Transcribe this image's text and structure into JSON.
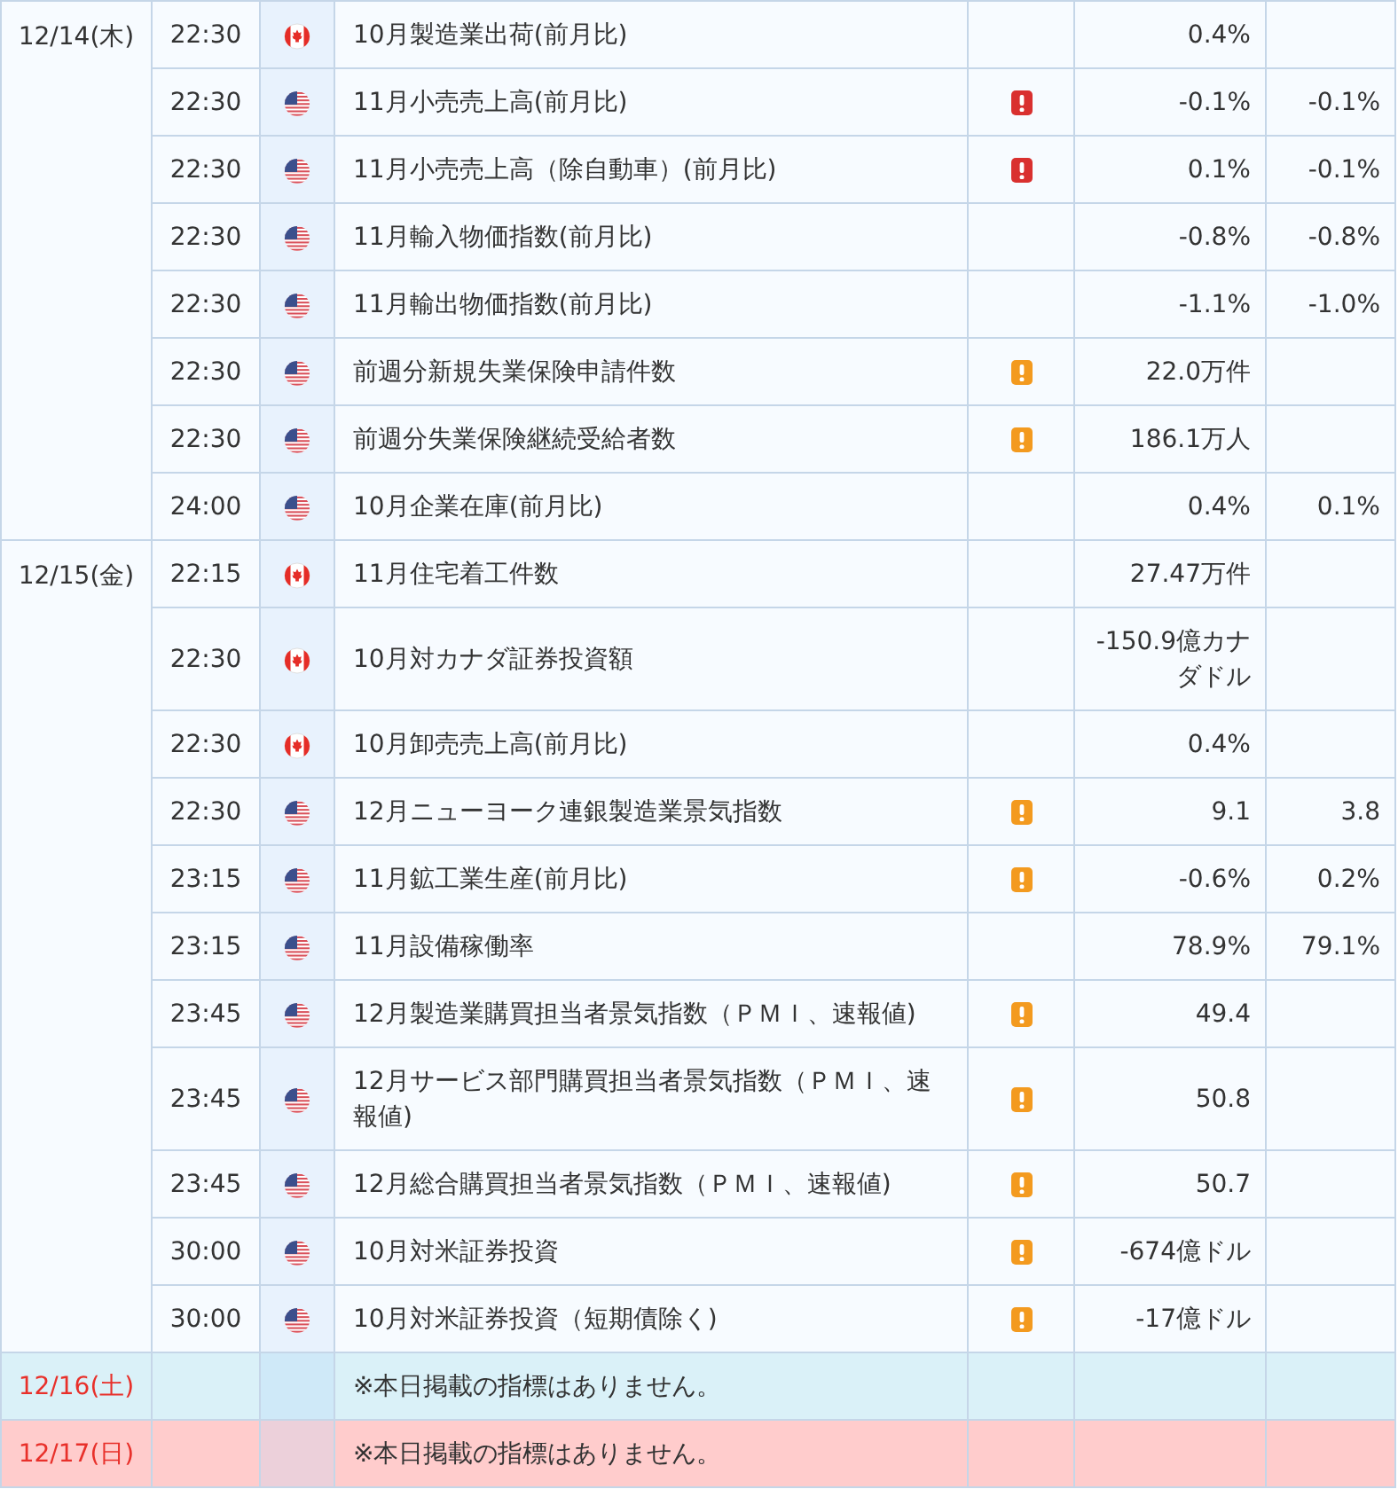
{
  "days": [
    {
      "date": "12/14(木)",
      "kind": "weekday",
      "events": [
        {
          "time": "22:30",
          "flag": {
            "kind": "canada"
          },
          "name": "10月製造業出荷(前月比)",
          "column_6": "0.4%"
        },
        {
          "time": "22:30",
          "flag": {
            "kind": "usa"
          },
          "name": "11月小売売上高(前月比)",
          "alert": {
            "kind": "high"
          },
          "column_6": "-0.1%",
          "column_7": "-0.1%"
        },
        {
          "time": "22:30",
          "flag": {
            "kind": "usa"
          },
          "name": "11月小売売上高（除自動車）(前月比)",
          "alert": {
            "kind": "high"
          },
          "column_6": "0.1%",
          "column_7": "-0.1%"
        },
        {
          "time": "22:30",
          "flag": {
            "kind": "usa"
          },
          "name": "11月輸入物価指数(前月比)",
          "column_6": "-0.8%",
          "column_7": "-0.8%"
        },
        {
          "time": "22:30",
          "flag": {
            "kind": "usa"
          },
          "name": "11月輸出物価指数(前月比)",
          "column_6": "-1.1%",
          "column_7": "-1.0%"
        },
        {
          "time": "22:30",
          "flag": {
            "kind": "usa"
          },
          "name": "前週分新規失業保険申請件数",
          "alert": {
            "kind": "medium"
          },
          "column_6": "22.0万件"
        },
        {
          "time": "22:30",
          "flag": {
            "kind": "usa"
          },
          "name": "前週分失業保険継続受給者数",
          "alert": {
            "kind": "medium"
          },
          "column_6": "186.1万人"
        },
        {
          "time": "24:00",
          "flag": {
            "kind": "usa"
          },
          "name": "10月企業在庫(前月比)",
          "column_6": "0.4%",
          "column_7": "0.1%"
        }
      ]
    },
    {
      "date": "12/15(金)",
      "kind": "weekday",
      "events": [
        {
          "time": "22:15",
          "flag": {
            "kind": "canada"
          },
          "name": "11月住宅着工件数",
          "column_6": "27.47万件"
        },
        {
          "time": "22:30",
          "flag": {
            "kind": "canada"
          },
          "name": "10月対カナダ証券投資額",
          "column_6": "-150.9億カナダドル"
        },
        {
          "time": "22:30",
          "flag": {
            "kind": "canada"
          },
          "name": "10月卸売売上高(前月比)",
          "column_6": "0.4%"
        },
        {
          "time": "22:30",
          "flag": {
            "kind": "usa"
          },
          "name": "12月ニューヨーク連銀製造業景気指数",
          "alert": {
            "kind": "medium"
          },
          "column_6": "9.1",
          "column_7": "3.8"
        },
        {
          "time": "23:15",
          "flag": {
            "kind": "usa"
          },
          "name": "11月鉱工業生産(前月比)",
          "alert": {
            "kind": "medium"
          },
          "column_6": "-0.6%",
          "column_7": "0.2%"
        },
        {
          "time": "23:15",
          "flag": {
            "kind": "usa"
          },
          "name": "11月設備稼働率",
          "column_6": "78.9%",
          "column_7": "79.1%"
        },
        {
          "time": "23:45",
          "flag": {
            "kind": "usa"
          },
          "name": "12月製造業購買担当者景気指数（ＰＭＩ、速報値)",
          "alert": {
            "kind": "medium"
          },
          "column_6": "49.4"
        },
        {
          "time": "23:45",
          "flag": {
            "kind": "usa"
          },
          "name": "12月サービス部門購買担当者景気指数（ＰＭＩ、速報値)",
          "alert": {
            "kind": "medium"
          },
          "column_6": "50.8"
        },
        {
          "time": "23:45",
          "flag": {
            "kind": "usa"
          },
          "name": "12月総合購買担当者景気指数（ＰＭＩ、速報値)",
          "alert": {
            "kind": "medium"
          },
          "column_6": "50.7"
        },
        {
          "time": "30:00",
          "flag": {
            "kind": "usa"
          },
          "name": "10月対米証券投資",
          "alert": {
            "kind": "medium"
          },
          "column_6": "-674億ドル"
        },
        {
          "time": "30:00",
          "flag": {
            "kind": "usa"
          },
          "name": "10月対米証券投資（短期債除く)",
          "alert": {
            "kind": "medium"
          },
          "column_6": "-17億ドル"
        }
      ]
    },
    {
      "date": "12/16(土)",
      "kind": "saturday",
      "note": "※本日掲載の指標はありません。"
    },
    {
      "date": "12/17(日)",
      "kind": "sunday",
      "note": "※本日掲載の指標はありません。"
    }
  ]
}
